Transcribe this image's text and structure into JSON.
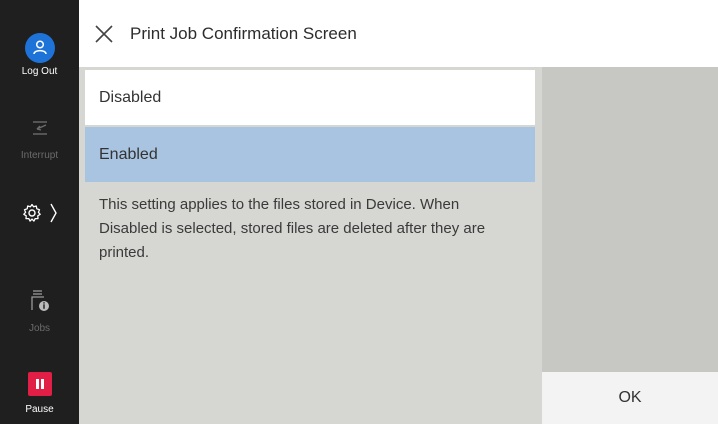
{
  "sidebar": {
    "logout_label": "Log Out",
    "interrupt_label": "Interrupt",
    "jobs_label": "Jobs",
    "pause_label": "Pause"
  },
  "header": {
    "title": "Print Job Confirmation Screen"
  },
  "options": [
    {
      "label": "Disabled",
      "selected": false
    },
    {
      "label": "Enabled",
      "selected": true
    }
  ],
  "description": "This setting applies to the files stored in Device. When Disabled is selected, stored files are deleted after they are printed.",
  "footer": {
    "ok_label": "OK"
  },
  "colors": {
    "logout_accent": "#1e73d8",
    "pause_accent": "#e01e46",
    "selected_bg": "#a9c4e0"
  }
}
